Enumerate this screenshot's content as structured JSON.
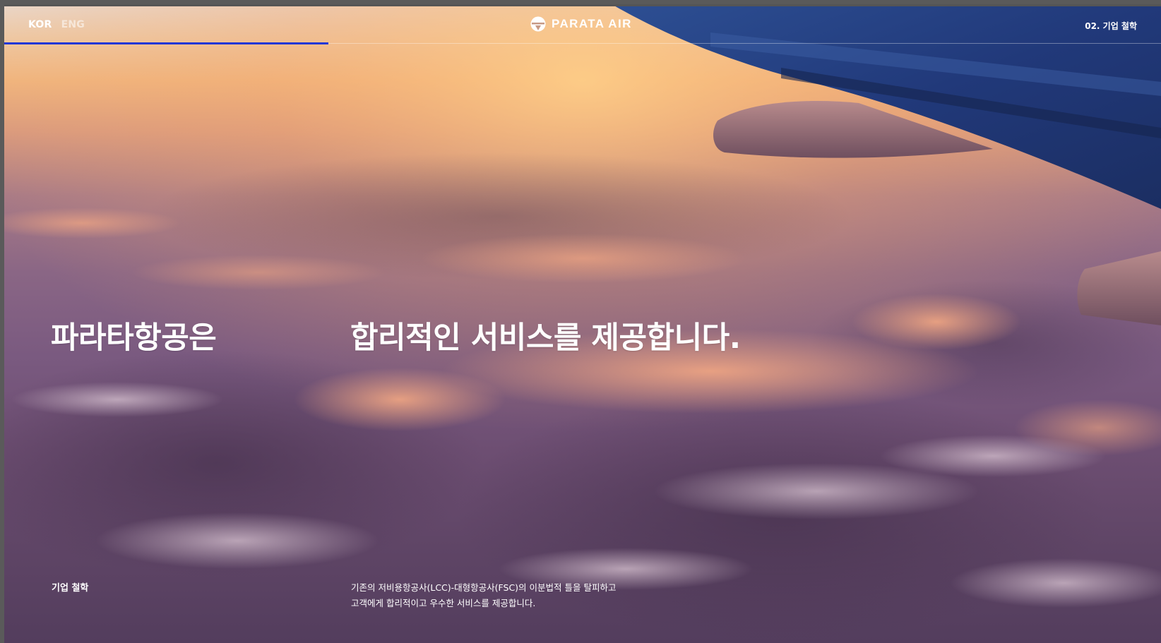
{
  "header": {
    "lang_kor": "KOR",
    "lang_eng": "ENG",
    "logo_text": "PARATA AIR",
    "nav_current": "02. 기업 철학"
  },
  "hero": {
    "headline_left": "파라타항공은",
    "headline_right": "합리적인 서비스를 제공합니다."
  },
  "section": {
    "label": "기업 철학",
    "description_lines": [
      "기존의 저비용항공사(LCC)-대형항공사(FSC)의 이분법적 틀을 탈피하고",
      "고객에게 합리적이고 우수한 서비스를 제공합니다."
    ]
  },
  "progress": {
    "fraction": 0.28
  },
  "colors": {
    "accent": "#2137d6",
    "wing_blue": "#23407c",
    "text": "#ffffff"
  }
}
